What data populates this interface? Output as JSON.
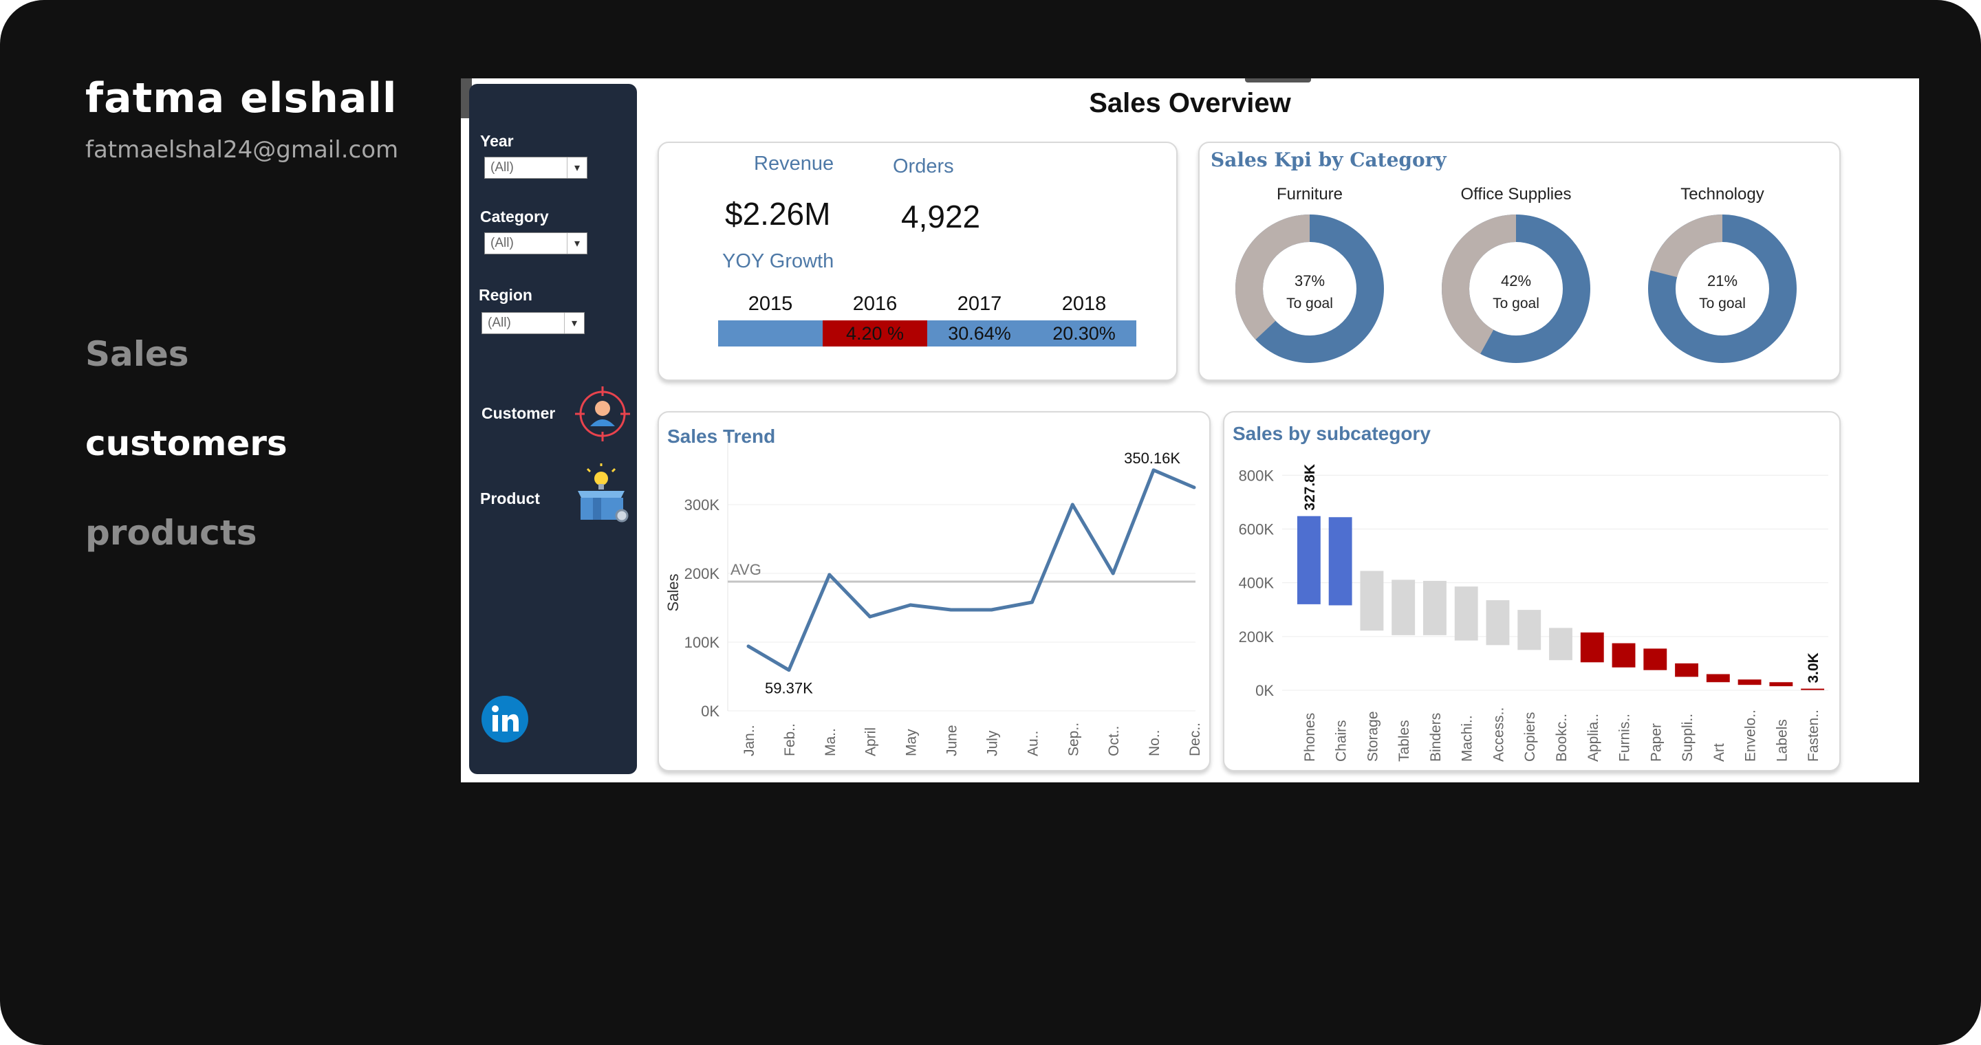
{
  "profile": {
    "name": "fatma elshall",
    "email": "fatmaelshal24@gmail.com"
  },
  "nav": {
    "sales": "Sales",
    "customers": "customers",
    "products": "products"
  },
  "dashboard": {
    "title": "Sales Overview",
    "filters": {
      "year": {
        "label": "Year",
        "value": "(All)"
      },
      "category": {
        "label": "Category",
        "value": "(All)"
      },
      "region": {
        "label": "Region",
        "value": "(All)"
      },
      "customer_label": "Customer",
      "product_label": "Product",
      "icons": {
        "customer": "customer-target-icon",
        "product": "product-box-icon",
        "linkedin": "linkedin-icon"
      }
    },
    "kpi": {
      "revenue_label": "Revenue",
      "revenue_value": "$2.26M",
      "orders_label": "Orders",
      "orders_value": "4,922",
      "yoy_label": "YOY Growth",
      "years": [
        "2015",
        "2016",
        "2017",
        "2018"
      ],
      "growth": [
        "",
        "4.20 %",
        "30.64%",
        "20.30%"
      ],
      "growth_colors": [
        "#5b8fc7",
        "#b00000",
        "#5b8fc7",
        "#5b8fc7"
      ]
    },
    "category_kpi": {
      "title": "Sales Kpi by Category",
      "colors": {
        "achieved": "#4e79a7",
        "remaining": "#bab0ac"
      },
      "items": [
        {
          "name": "Furniture",
          "pct": 37,
          "label": "37%",
          "sub": "To goal"
        },
        {
          "name": "Office Supplies",
          "pct": 42,
          "label": "42%",
          "sub": "To goal"
        },
        {
          "name": "Technology",
          "pct": 21,
          "label": "21%",
          "sub": "To goal"
        }
      ]
    }
  },
  "chart_data": [
    {
      "type": "line",
      "title": "Sales Trend",
      "ylabel": "Sales",
      "x": [
        "Jan..",
        "Feb..",
        "Ma..",
        "April",
        "May",
        "June",
        "July",
        "Au..",
        "Sep..",
        "Oct..",
        "No..",
        "Dec.."
      ],
      "values": [
        94,
        59.37,
        198,
        137,
        154,
        147,
        147,
        158,
        300,
        200,
        350.16,
        325
      ],
      "ylim": [
        0,
        360
      ],
      "yticks": [
        0,
        100,
        200,
        300
      ],
      "ytick_labels": [
        "0K",
        "100K",
        "200K",
        "300K"
      ],
      "reference_line": {
        "label": "AVG",
        "value": 188
      },
      "annotations": [
        {
          "text": "59.37K",
          "index": 1
        },
        {
          "text": "350.16K",
          "index": 10
        }
      ],
      "color": "#4e79a7"
    },
    {
      "type": "bar",
      "title": "Sales by subcategory",
      "categories": [
        "Phones",
        "Chairs",
        "Storage",
        "Tables",
        "Binders",
        "Machi..",
        "Access..",
        "Copiers",
        "Bookc..",
        "Applia..",
        "Furnis..",
        "Paper",
        "Suppli..",
        "Art",
        "Envelo..",
        "Labels",
        "Fasten.."
      ],
      "ranges": [
        [
          320,
          648
        ],
        [
          316,
          644
        ],
        [
          222,
          444
        ],
        [
          205,
          411
        ],
        [
          205,
          407
        ],
        [
          185,
          386
        ],
        [
          168,
          335
        ],
        [
          150,
          299
        ],
        [
          112,
          232
        ],
        [
          104,
          215
        ],
        [
          85,
          175
        ],
        [
          75,
          155
        ],
        [
          50,
          100
        ],
        [
          30,
          60
        ],
        [
          20,
          40
        ],
        [
          15,
          30
        ],
        [
          3,
          6
        ]
      ],
      "colors": [
        "#4e6fd0",
        "#4e6fd0",
        "#d7d7d7",
        "#d7d7d7",
        "#d7d7d7",
        "#d7d7d7",
        "#d7d7d7",
        "#d7d7d7",
        "#d7d7d7",
        "#b00000",
        "#b00000",
        "#b00000",
        "#b00000",
        "#b00000",
        "#b00000",
        "#b00000",
        "#b00000"
      ],
      "ylim": [
        0,
        880
      ],
      "yticks": [
        0,
        200,
        400,
        600,
        800
      ],
      "ytick_labels": [
        "0K",
        "200K",
        "400K",
        "600K",
        "800K"
      ],
      "annotations": [
        {
          "text": "327.8K",
          "index": 0
        },
        {
          "text": "3.0K",
          "index": 16
        }
      ]
    }
  ]
}
